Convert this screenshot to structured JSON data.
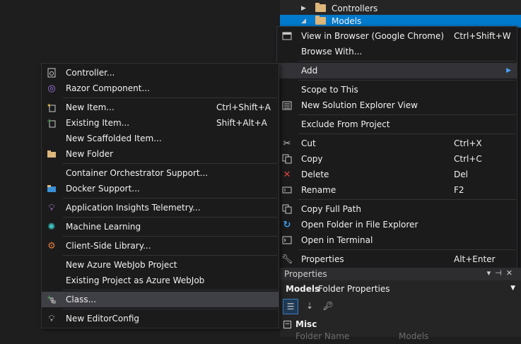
{
  "tree": {
    "controllers": "Controllers",
    "models": "Models"
  },
  "main_menu": [
    {
      "label": "View in Browser (Google Chrome)",
      "shortcut": "Ctrl+Shift+W",
      "icon": "browser-icon"
    },
    {
      "label": "Browse With...",
      "shortcut": "",
      "icon": ""
    },
    {
      "label": "Add",
      "shortcut": "",
      "icon": "",
      "submenu": true
    },
    {
      "label": "Scope to This",
      "shortcut": "",
      "icon": ""
    },
    {
      "label": "New Solution Explorer View",
      "shortcut": "",
      "icon": "solution-view-icon"
    },
    {
      "label": "Exclude From Project",
      "shortcut": "",
      "icon": ""
    },
    {
      "label": "Cut",
      "shortcut": "Ctrl+X",
      "icon": "scissors-icon"
    },
    {
      "label": "Copy",
      "shortcut": "Ctrl+C",
      "icon": "copy-icon"
    },
    {
      "label": "Delete",
      "shortcut": "Del",
      "icon": "delete-icon"
    },
    {
      "label": "Rename",
      "shortcut": "F2",
      "icon": "rename-icon"
    },
    {
      "label": "Copy Full Path",
      "shortcut": "",
      "icon": "copy-path-icon"
    },
    {
      "label": "Open Folder in File Explorer",
      "shortcut": "",
      "icon": "open-folder-icon"
    },
    {
      "label": "Open in Terminal",
      "shortcut": "",
      "icon": "terminal-icon"
    },
    {
      "label": "Properties",
      "shortcut": "Alt+Enter",
      "icon": "wrench-icon"
    }
  ],
  "add_menu": [
    {
      "label": "Controller...",
      "shortcut": "",
      "icon": "controller-icon"
    },
    {
      "label": "Razor Component...",
      "shortcut": "",
      "icon": "razor-icon"
    },
    {
      "label": "New Item...",
      "shortcut": "Ctrl+Shift+A",
      "icon": "new-item-icon"
    },
    {
      "label": "Existing Item...",
      "shortcut": "Shift+Alt+A",
      "icon": "existing-item-icon"
    },
    {
      "label": "New Scaffolded Item...",
      "shortcut": "",
      "icon": ""
    },
    {
      "label": "New Folder",
      "shortcut": "",
      "icon": "new-folder-icon"
    },
    {
      "label": "Container Orchestrator Support...",
      "shortcut": "",
      "icon": ""
    },
    {
      "label": "Docker Support...",
      "shortcut": "",
      "icon": "docker-icon"
    },
    {
      "label": "Application Insights Telemetry...",
      "shortcut": "",
      "icon": "insights-icon"
    },
    {
      "label": "Machine Learning",
      "shortcut": "",
      "icon": "ml-icon"
    },
    {
      "label": "Client-Side Library...",
      "shortcut": "",
      "icon": "library-icon"
    },
    {
      "label": "New Azure WebJob Project",
      "shortcut": "",
      "icon": ""
    },
    {
      "label": "Existing Project as Azure WebJob",
      "shortcut": "",
      "icon": ""
    },
    {
      "label": "Class...",
      "shortcut": "",
      "icon": "class-icon"
    },
    {
      "label": "New EditorConfig",
      "shortcut": "",
      "icon": "editorconfig-icon"
    }
  ],
  "properties": {
    "title": "Properties",
    "object_name": "Models",
    "object_desc": "Folder Properties",
    "category": "Misc",
    "row_key": "Folder Name",
    "row_value": "Models"
  },
  "colors": {
    "selection": "#007acc",
    "highlight": "#3f3f46",
    "menu_bg": "#1b1b1c"
  }
}
